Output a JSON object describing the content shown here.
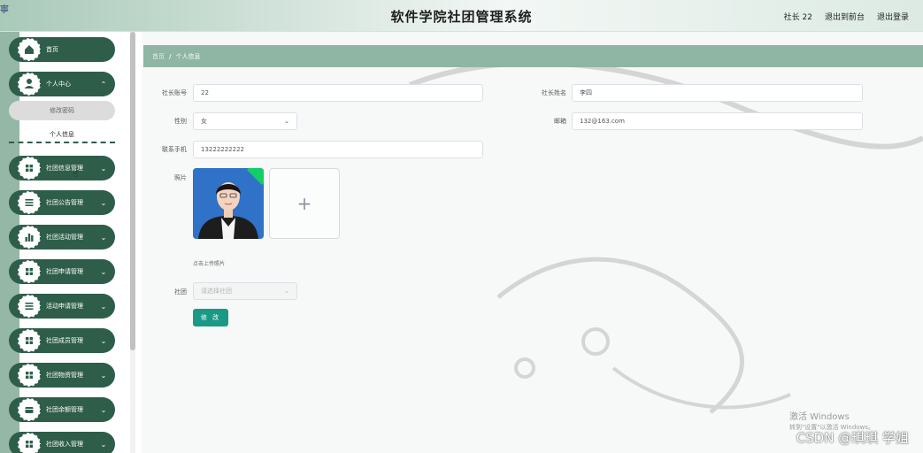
{
  "header": {
    "corner_glyph": "寧",
    "title": "软件学院社团管理系统",
    "user": "社长 22",
    "to_front": "退出到前台",
    "logout": "退出登录"
  },
  "sidebar": {
    "items": [
      {
        "label": "首页",
        "icon": "home-icon"
      },
      {
        "label": "个人中心",
        "icon": "user-icon"
      },
      {
        "label": "社团信息管理",
        "icon": "grid-icon"
      },
      {
        "label": "社团公告管理",
        "icon": "list-icon"
      },
      {
        "label": "社团活动管理",
        "icon": "bar-chart-icon"
      },
      {
        "label": "社团申请管理",
        "icon": "grid-icon"
      },
      {
        "label": "活动申请管理",
        "icon": "list-icon"
      },
      {
        "label": "社团成员管理",
        "icon": "grid-icon"
      },
      {
        "label": "社团物资管理",
        "icon": "grid-icon"
      },
      {
        "label": "社团余额管理",
        "icon": "wallet-icon"
      },
      {
        "label": "社团收入管理",
        "icon": "grid-icon"
      }
    ],
    "sub_items": [
      {
        "label": "修改密码"
      },
      {
        "label": "个人信息"
      }
    ],
    "menu_color": "#2e5e4a",
    "accent_color": "#94b7a6"
  },
  "breadcrumb": {
    "home": "首页",
    "separator": "/",
    "current": "个人信息"
  },
  "form": {
    "account_label": "社长账号",
    "account_value": "22",
    "name_label": "社长姓名",
    "name_value": "李四",
    "gender_label": "性别",
    "gender_value": "女",
    "email_label": "邮箱",
    "email_value": "132@163.com",
    "phone_label": "联系手机",
    "phone_value": "13222222222",
    "photo_label": "照片",
    "upload_symbol": "+",
    "upload_hint": "点击上传照片",
    "club_label": "社团",
    "club_placeholder": "请选择社团",
    "submit_label": "修 改",
    "button_color": "#1a9a84"
  },
  "watermark": {
    "line1": "激活 Windows",
    "line2": "转到\"设置\"以激活 Windows。"
  },
  "footer": {
    "csdn": "CSDN @琪琪 学姐"
  }
}
